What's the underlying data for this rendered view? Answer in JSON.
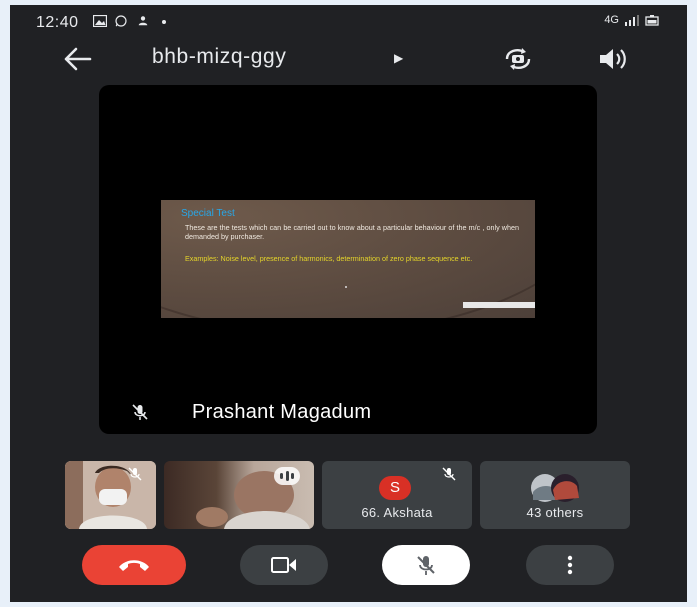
{
  "status_bar": {
    "time": "12:40",
    "network": "4G"
  },
  "header": {
    "meeting_code": "bhb-mizq-ggy",
    "icons": [
      "back-arrow-icon",
      "expand-caret-icon",
      "flip-camera-icon",
      "speaker-icon"
    ]
  },
  "main_tile": {
    "participant_name": "Prashant Magadum",
    "mic_muted": true,
    "slide": {
      "title": "Special Test",
      "body": "These are the tests which can be carried out to know about a particular behaviour of the m/c , only when demanded by purchaser.",
      "examples": "Examples: Noise level, presence of harmonics, determination of zero phase sequence etc."
    }
  },
  "participants": [
    {
      "type": "video",
      "mic_muted": true
    },
    {
      "type": "video",
      "speaking": true
    },
    {
      "type": "avatar",
      "initial": "S",
      "label": "66. Akshata",
      "mic_muted": true,
      "avatar_color": "#d93025"
    },
    {
      "type": "group",
      "label": "43 others"
    }
  ],
  "controls": {
    "end_call_color": "#ea4335",
    "icons": [
      "end-call-icon",
      "video-camera-icon",
      "mic-off-icon",
      "more-options-icon"
    ]
  }
}
